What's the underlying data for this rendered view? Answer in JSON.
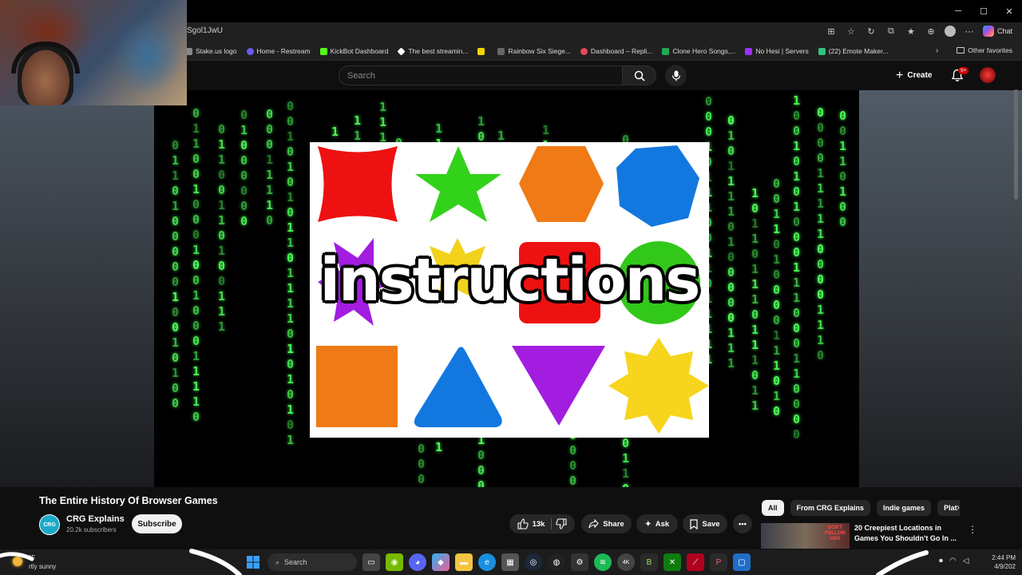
{
  "browser": {
    "url": "Sgol1JwU",
    "window_controls": {
      "minimize": "─",
      "maximize": "☐",
      "close": "✕"
    },
    "copilot_label": "Chat",
    "bookmarks": [
      {
        "label": "Stake.us logo",
        "color": "#888888"
      },
      {
        "label": "Home - Restream",
        "color": "#6b5cf0"
      },
      {
        "label": "KickBot Dashboard",
        "color": "#53fc18"
      },
      {
        "label": "The best streamin...",
        "color": "#ffffff"
      },
      {
        "label": "",
        "color": "#f5d400"
      },
      {
        "label": "Rainbow Six Siege...",
        "color": "#666666"
      },
      {
        "label": "Dashboard – Repli...",
        "color": "#e8455b"
      },
      {
        "label": "Clone Hero Songs,...",
        "color": "#1faa59"
      },
      {
        "label": "No Hesi | Servers",
        "color": "#9b30ff"
      },
      {
        "label": "(22) Emote Maker...",
        "color": "#2ec27e"
      }
    ],
    "other_favorites": "Other favorites"
  },
  "youtube": {
    "search_placeholder": "Search",
    "create_label": "Create",
    "notif_count": "9+",
    "video_overlay_text": "instructions",
    "video_title": "The Entire History Of Browser Games",
    "channel": {
      "logo_text": "CRG",
      "name": "CRG Explains",
      "subscribers": "20.2k subscribers"
    },
    "subscribe_label": "Subscribe",
    "likes": "13k",
    "share_label": "Share",
    "ask_label": "Ask",
    "save_label": "Save",
    "chips": [
      "All",
      "From CRG Explains",
      "Indie games",
      "Plat"
    ],
    "recommended": {
      "title": "20 Creepiest Locations in Games You Shouldn't Go In ...",
      "thumb_text": "DON'T FOLLOW HER"
    }
  },
  "taskbar": {
    "weather_temp": "°F",
    "weather_desc": "rtly sunny",
    "search_label": "Search",
    "time": "2:44 PM",
    "date": "4/9/202"
  }
}
